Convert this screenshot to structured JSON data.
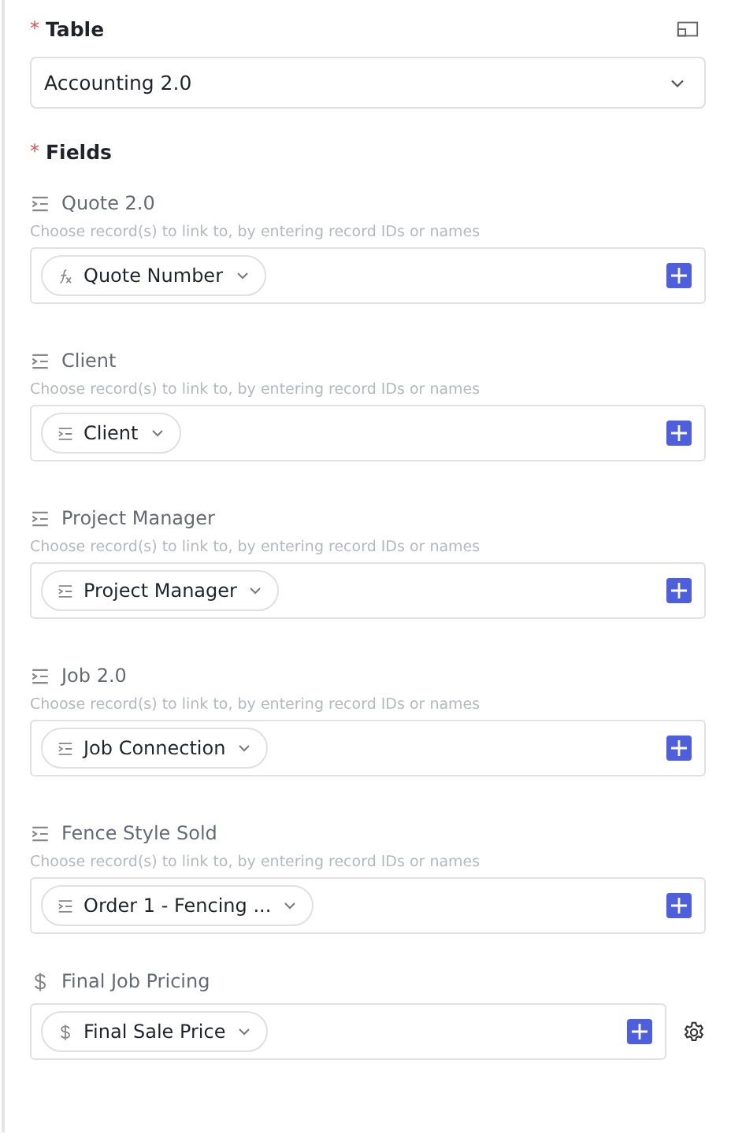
{
  "table": {
    "mark": "*",
    "label": "Table",
    "value": "Accounting 2.0"
  },
  "fields_label": {
    "mark": "*",
    "label": "Fields"
  },
  "fields": [
    {
      "kind": "link",
      "label": "Quote 2.0",
      "hint": "Choose record(s) to link to, by entering record IDs or names",
      "tag": {
        "kind": "formula",
        "text": "Quote Number"
      },
      "settings": false
    },
    {
      "kind": "link",
      "label": "Client",
      "hint": "Choose record(s) to link to, by entering record IDs or names",
      "tag": {
        "kind": "link",
        "text": "Client"
      },
      "settings": false
    },
    {
      "kind": "link",
      "label": "Project Manager",
      "hint": "Choose record(s) to link to, by entering record IDs or names",
      "tag": {
        "kind": "link",
        "text": "Project Manager"
      },
      "settings": false
    },
    {
      "kind": "link",
      "label": "Job 2.0",
      "hint": "Choose record(s) to link to, by entering record IDs or names",
      "tag": {
        "kind": "link",
        "text": "Job Connection"
      },
      "settings": false
    },
    {
      "kind": "link",
      "label": "Fence Style Sold",
      "hint": "Choose record(s) to link to, by entering record IDs or names",
      "tag": {
        "kind": "link",
        "text": "Order 1 - Fencing ..."
      },
      "settings": false
    },
    {
      "kind": "currency",
      "label": "Final Job Pricing",
      "tag": {
        "kind": "currency",
        "text": "Final Sale Price"
      },
      "settings": true
    }
  ]
}
